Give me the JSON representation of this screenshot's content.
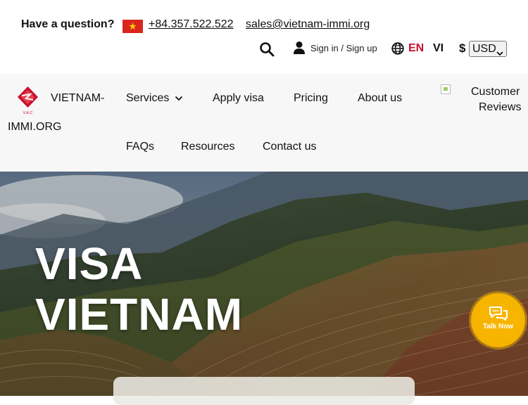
{
  "topbar": {
    "question": "Have a question?",
    "phone": "+84.357.522.522",
    "email": "sales@vietnam-immi.org",
    "signin": "Sign in / Sign up",
    "lang_en": "EN",
    "lang_vi": "VI",
    "currency_symbol": "$",
    "currency": "USD"
  },
  "nav": {
    "brand_line1": "VIETNAM-",
    "brand_line2": "IMMI.ORG",
    "logo_text": "V.A.C",
    "items": [
      {
        "label": "Services"
      },
      {
        "label": "Apply visa"
      },
      {
        "label": "Pricing"
      },
      {
        "label": "About us"
      },
      {
        "label": "FAQs"
      },
      {
        "label": "Resources"
      },
      {
        "label": "Contact us"
      }
    ],
    "reviews_line1": "Customer",
    "reviews_line2": "Reviews"
  },
  "hero": {
    "title_line1": "VISA",
    "title_line2": "VIETNAM"
  },
  "chat": {
    "label": "Talk Now"
  },
  "colors": {
    "accent_red": "#c8102e",
    "flag_red": "#da251d",
    "flag_star": "#ffcd00",
    "chat_yellow": "#f4b400",
    "nav_bg": "#f7f7f7"
  },
  "icons": [
    "vietnam-flag-icon",
    "search-icon",
    "user-icon",
    "globe-icon",
    "chevron-down-icon",
    "chat-bubbles-icon",
    "broken-image-icon"
  ]
}
